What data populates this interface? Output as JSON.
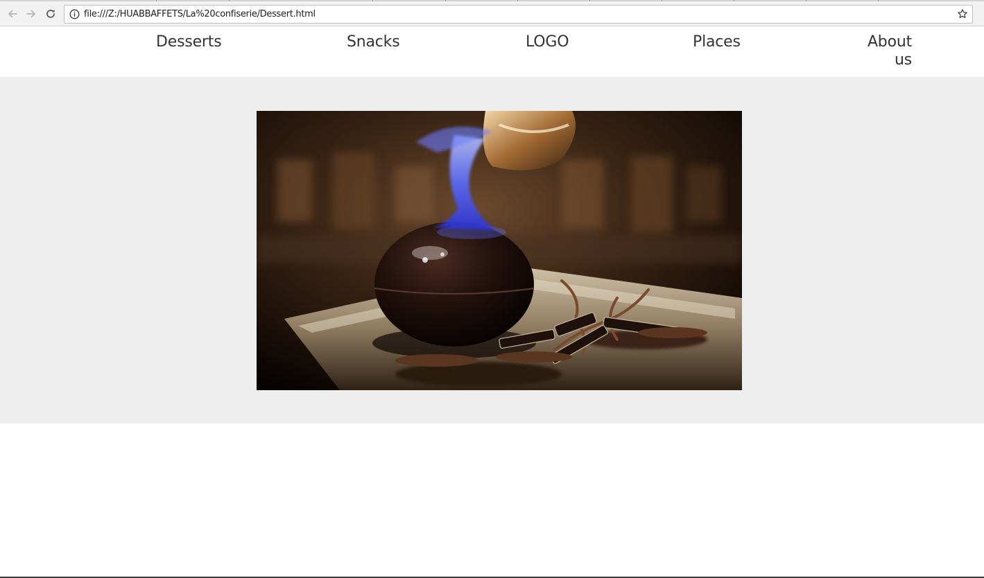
{
  "browser": {
    "url": "file:///Z:/HUABBAFFETS/La%20confiserie/Dessert.html",
    "icons": [
      "back-arrow-icon",
      "forward-arrow-icon",
      "reload-icon",
      "info-icon",
      "star-icon"
    ]
  },
  "nav": {
    "desserts": "Desserts",
    "snacks": "Snacks",
    "logo": "LOGO",
    "places": "Places",
    "about_line1": "About",
    "about_line2": "us"
  },
  "hero": {
    "image": "flambe-chocolate-sphere-dessert"
  },
  "colors": {
    "hero_background": "#eeeeee",
    "nav_text": "#333333",
    "flame": "#5b6cff"
  }
}
